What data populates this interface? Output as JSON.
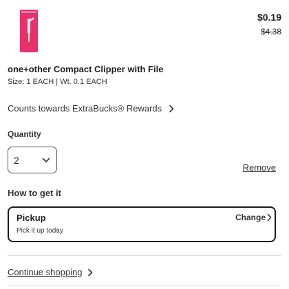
{
  "product": {
    "image_icon": "nail-clipper-package-icon",
    "title": "one+other Compact Clipper with File",
    "meta": "Size: 1 EACH | Wt. 0.1 EACH",
    "price_now": "$0.19",
    "price_was": "$4.38"
  },
  "rewards": {
    "label": "Counts towards ExtraBucks® Rewards",
    "icon": "chevron-right-icon"
  },
  "quantity": {
    "label": "Quantity",
    "value": "2",
    "icon": "chevron-down-icon"
  },
  "remove_label": "Remove",
  "fulfillment": {
    "heading": "How to get it",
    "option_title": "Pickup",
    "option_subtitle": "Pick it up today",
    "change_label": "Change"
  },
  "continue_label": "Continue shopping",
  "colors": {
    "package_pink": "#e8306a",
    "border_dark": "#1a1a1a",
    "text": "#222222"
  }
}
